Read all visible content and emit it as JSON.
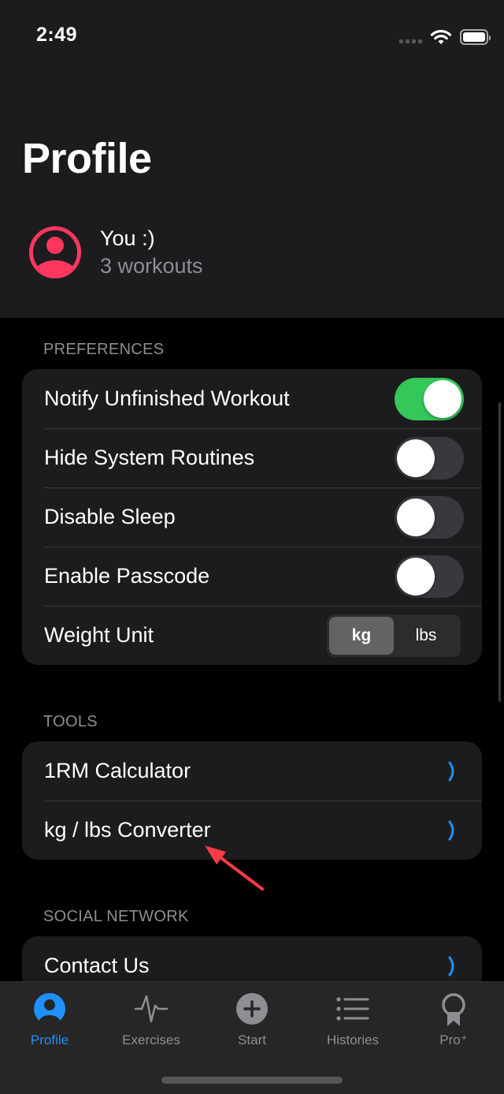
{
  "status_bar": {
    "time": "2:49",
    "icons": [
      "cellular-signal-icon",
      "wifi-icon",
      "battery-icon"
    ]
  },
  "header": {
    "title": "Profile"
  },
  "user": {
    "avatar_icon": "person-circle-icon",
    "name": "You :)",
    "subtitle": "3 workouts",
    "accent_color": "#ff375f"
  },
  "sections": {
    "preferences": {
      "title": "PREFERENCES",
      "rows": [
        {
          "label": "Notify Unfinished Workout",
          "type": "toggle",
          "on": true
        },
        {
          "label": "Hide System Routines",
          "type": "toggle",
          "on": false
        },
        {
          "label": "Disable Sleep",
          "type": "toggle",
          "on": false
        },
        {
          "label": "Enable Passcode",
          "type": "toggle",
          "on": false
        },
        {
          "label": "Weight Unit",
          "type": "segmented",
          "options": [
            "kg",
            "lbs"
          ],
          "selected": "kg"
        }
      ]
    },
    "tools": {
      "title": "TOOLS",
      "rows": [
        {
          "label": "1RM Calculator",
          "icon": "chevron-right-icon"
        },
        {
          "label": "kg / lbs Converter",
          "icon": "chevron-right-icon"
        }
      ]
    },
    "social": {
      "title": "SOCIAL NETWORK",
      "rows": [
        {
          "label": "Contact Us",
          "icon": "chevron-right-icon"
        }
      ]
    }
  },
  "tab_bar": {
    "active": "Profile",
    "active_color": "#1e90ff",
    "tabs": [
      {
        "label": "Profile",
        "icon": "person-circle-icon"
      },
      {
        "label": "Exercises",
        "icon": "heartbeat-icon"
      },
      {
        "label": "Start",
        "icon": "plus-circle-icon"
      },
      {
        "label": "Histories",
        "icon": "list-icon"
      },
      {
        "label": "Pro⁺",
        "icon": "award-ribbon-icon"
      }
    ]
  },
  "colors": {
    "toggle_on": "#34c759",
    "chevron": "#1e90ff",
    "annotation_arrow": "#ff3b47"
  }
}
